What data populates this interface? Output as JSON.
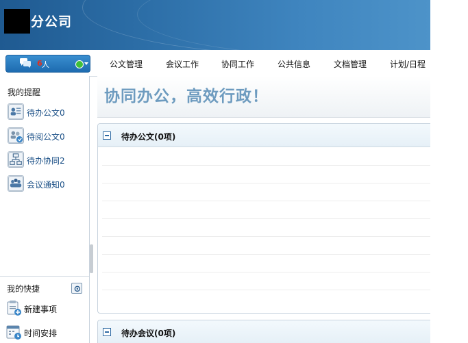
{
  "header": {
    "company_suffix": "分公司"
  },
  "user_menu": {
    "online_count": "6",
    "online_unit": "人",
    "status_color": "#3fbf3a"
  },
  "nav": {
    "items": [
      "公文管理",
      "会议工作",
      "协同工作",
      "公共信息",
      "文档管理",
      "计划/日程"
    ]
  },
  "sidebar": {
    "reminders_title": "我的提醒",
    "reminders": [
      {
        "label": "待办公文0",
        "icon": "pending-document-icon"
      },
      {
        "label": "待阅公文0",
        "icon": "to-read-document-icon"
      },
      {
        "label": "待办协同2",
        "icon": "collaboration-icon"
      },
      {
        "label": "会议通知0",
        "icon": "meeting-notice-icon"
      }
    ],
    "shortcuts_title": "我的快捷",
    "shortcuts": [
      {
        "label": "新建事项",
        "icon": "new-item-icon"
      },
      {
        "label": "时间安排",
        "icon": "schedule-icon"
      }
    ]
  },
  "main": {
    "slogan": "协同办公，高效行政！",
    "panels": [
      {
        "title": "待办公文(0项)"
      },
      {
        "title": "待办会议(0项)"
      }
    ]
  },
  "colors": {
    "accent": "#2d6fa8",
    "slogan": "#6d9bbf",
    "link": "#1a4f86"
  }
}
